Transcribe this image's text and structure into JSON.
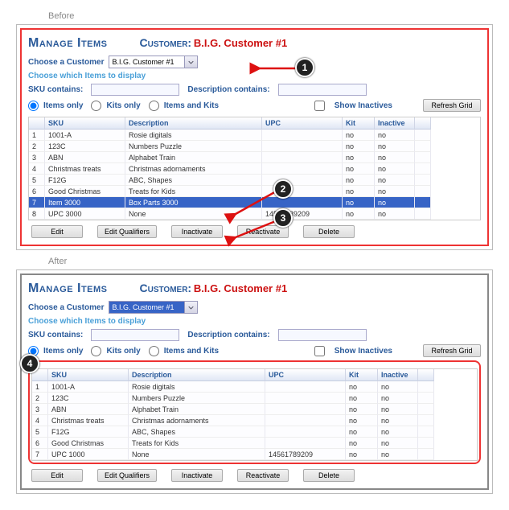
{
  "labels": {
    "before": "Before",
    "after": "After",
    "manage_items": "Manage Items",
    "customer_label": "Customer:",
    "choose_customer": "Choose a Customer",
    "choose_items": "Choose which Items to display",
    "sku_contains": "SKU contains:",
    "desc_contains": "Description contains:",
    "items_only": "Items only",
    "kits_only": "Kits only",
    "items_and_kits": "Items and Kits",
    "show_inactives": "Show Inactives",
    "refresh": "Refresh Grid",
    "edit": "Edit",
    "edit_qualifiers": "Edit Qualifiers",
    "inactivate": "Inactivate",
    "reactivate": "Reactivate",
    "delete": "Delete"
  },
  "customer_value": "B.I.G. Customer #1",
  "columns": {
    "sku": "SKU",
    "description": "Description",
    "upc": "UPC",
    "kit": "Kit",
    "inactive": "Inactive"
  },
  "before_rows": [
    {
      "n": "1",
      "sku": "1001-A",
      "desc": "Rosie digitals",
      "upc": "",
      "kit": "no",
      "inactive": "no"
    },
    {
      "n": "2",
      "sku": "123C",
      "desc": "Numbers Puzzle",
      "upc": "",
      "kit": "no",
      "inactive": "no"
    },
    {
      "n": "3",
      "sku": "ABN",
      "desc": "Alphabet Train",
      "upc": "",
      "kit": "no",
      "inactive": "no"
    },
    {
      "n": "4",
      "sku": "Christmas treats",
      "desc": "Christmas adornaments",
      "upc": "",
      "kit": "no",
      "inactive": "no"
    },
    {
      "n": "5",
      "sku": "F12G",
      "desc": "ABC, Shapes",
      "upc": "",
      "kit": "no",
      "inactive": "no"
    },
    {
      "n": "6",
      "sku": "Good Christmas",
      "desc": "Treats for Kids",
      "upc": "",
      "kit": "no",
      "inactive": "no"
    },
    {
      "n": "7",
      "sku": "Item 3000",
      "desc": "Box Parts 3000",
      "upc": "",
      "kit": "no",
      "inactive": "no",
      "selected": true
    },
    {
      "n": "8",
      "sku": "UPC 3000",
      "desc": "None",
      "upc": "14561789209",
      "kit": "no",
      "inactive": "no"
    }
  ],
  "after_rows": [
    {
      "n": "1",
      "sku": "1001-A",
      "desc": "Rosie digitals",
      "upc": "",
      "kit": "no",
      "inactive": "no"
    },
    {
      "n": "2",
      "sku": "123C",
      "desc": "Numbers Puzzle",
      "upc": "",
      "kit": "no",
      "inactive": "no"
    },
    {
      "n": "3",
      "sku": "ABN",
      "desc": "Alphabet Train",
      "upc": "",
      "kit": "no",
      "inactive": "no"
    },
    {
      "n": "4",
      "sku": "Christmas treats",
      "desc": "Christmas adornaments",
      "upc": "",
      "kit": "no",
      "inactive": "no"
    },
    {
      "n": "5",
      "sku": "F12G",
      "desc": "ABC, Shapes",
      "upc": "",
      "kit": "no",
      "inactive": "no"
    },
    {
      "n": "6",
      "sku": "Good Christmas",
      "desc": "Treats for Kids",
      "upc": "",
      "kit": "no",
      "inactive": "no"
    },
    {
      "n": "7",
      "sku": "UPC 1000",
      "desc": "None",
      "upc": "14561789209",
      "kit": "no",
      "inactive": "no"
    }
  ],
  "callouts": {
    "c1": "1",
    "c2": "2",
    "c3": "3",
    "c4": "4"
  }
}
